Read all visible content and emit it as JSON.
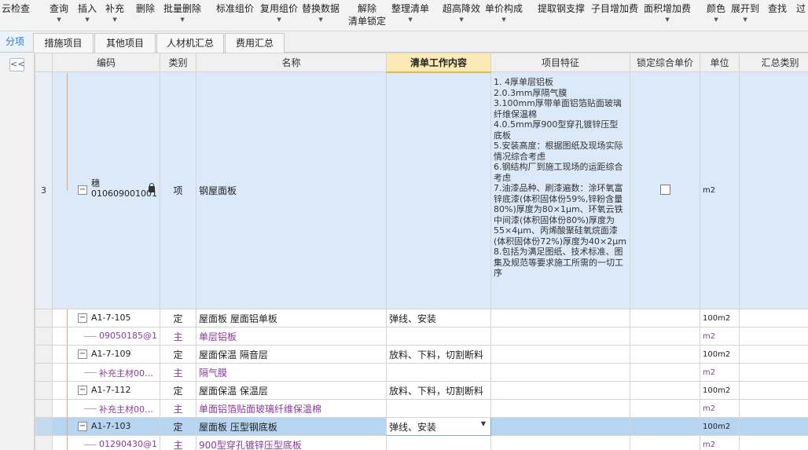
{
  "toolbar": {
    "items": [
      {
        "label": "云检查",
        "dropdown": false
      },
      {
        "label": "查询",
        "dropdown": true
      },
      {
        "label": "插入",
        "dropdown": true
      },
      {
        "label": "补充",
        "dropdown": true
      },
      {
        "label": "删除",
        "dropdown": false
      },
      {
        "label": "批量删除",
        "dropdown": true
      },
      {
        "label": "标准组价",
        "dropdown": false
      },
      {
        "label": "复用组价",
        "dropdown": true
      },
      {
        "label": "替换数据",
        "dropdown": true
      },
      {
        "label": "解除",
        "sub": "清单锁定",
        "dropdown": false
      },
      {
        "label": "整理清单",
        "dropdown": true
      },
      {
        "label": "超高降效",
        "dropdown": true
      },
      {
        "label": "单价构成",
        "dropdown": true
      },
      {
        "label": "提取钢支撑",
        "dropdown": false
      },
      {
        "label": "子目增加费",
        "dropdown": false
      },
      {
        "label": "面积增加费",
        "dropdown": true
      },
      {
        "label": "颜色",
        "dropdown": true
      },
      {
        "label": "展开到",
        "dropdown": true
      },
      {
        "label": "查找",
        "dropdown": false
      },
      {
        "label": "过",
        "dropdown": false
      }
    ]
  },
  "tabs": {
    "active": "分项",
    "items": [
      "措施项目",
      "其他项目",
      "人材机汇总",
      "费用汇总"
    ]
  },
  "collapse_button": "<<",
  "columns": {
    "code": "编码",
    "type": "类别",
    "name": "名称",
    "work": "清单工作内容",
    "feature": "项目特征",
    "lock": "锁定综合单价",
    "unit": "单位",
    "summary": "汇总类别"
  },
  "main_row": {
    "row_no": "3",
    "code_top": "穗",
    "code": "010609001001",
    "type": "项",
    "name": "钢屋面板",
    "unit": "m2",
    "locked": false,
    "feature": [
      "1. 4厚单层铝板",
      "2.0.3mm厚隔气膜",
      "3.100mm厚带单面铝箔贴面玻璃纤维保温棉",
      "4.0.5mm厚900型穿孔镀锌压型底板",
      "5.安装高度：根据图纸及现场实际情况综合考虑",
      "6.钢结构厂到施工现场的运距综合考虑",
      "7.油漆品种、刷漆遍数：涂环氧富锌底漆(体积固体份59%,锌粉含量80%)厚度为80×1μm、环氧云铁中间漆(体积固体份80%)厚度为55×4μm、丙烯酸聚硅氧烷面漆(体积固体份72%)厚度为40×2μm",
      "8.包括为满足图纸、技术标准、图集及规范等要求施工所需的一切工序"
    ]
  },
  "rows": [
    {
      "code": "A1-7-105",
      "type": "定",
      "name": "屋面板 屋面铝单板",
      "work": "弹线、安装",
      "unit": "100m2",
      "child": false
    },
    {
      "code": "09050185@1",
      "type": "主",
      "name": "单层铝板",
      "work": "",
      "unit": "m2",
      "child": true
    },
    {
      "code": "A1-7-109",
      "type": "定",
      "name": "屋面保温 隔音层",
      "work": "放料、下料，切割断料",
      "unit": "100m2",
      "child": false
    },
    {
      "code": "补充主材00…",
      "type": "主",
      "name": "隔气膜",
      "work": "",
      "unit": "m2",
      "child": true
    },
    {
      "code": "A1-7-112",
      "type": "定",
      "name": "屋面保温 保温层",
      "work": "放料、下料，切割断料",
      "unit": "100m2",
      "child": false
    },
    {
      "code": "补充主材00…",
      "type": "主",
      "name": "单面铝箔贴面玻璃纤维保温棉",
      "work": "",
      "unit": "m2",
      "child": true
    },
    {
      "code": "A1-7-103",
      "type": "定",
      "name": "屋面板 压型钢底板",
      "work": "弹线、安装",
      "unit": "100m2",
      "child": false,
      "selected": true
    },
    {
      "code": "01290430@1",
      "type": "主",
      "name": "900型穿孔镀锌压型底板",
      "work": "",
      "unit": "m2",
      "child": true
    }
  ]
}
